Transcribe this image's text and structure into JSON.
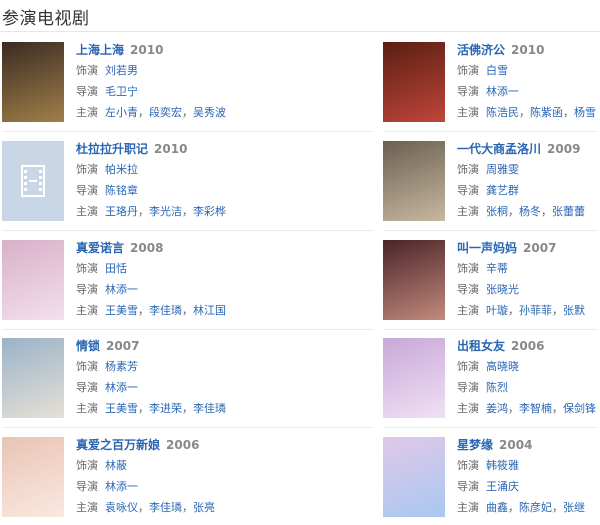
{
  "section_title": "参演电视剧",
  "role_label": "饰演",
  "director_label": "导演",
  "cast_label": "主演",
  "dramas": [
    {
      "title": "上海上海",
      "year": "2010",
      "role": "刘若男",
      "director": "毛卫宁",
      "cast": [
        "左小青",
        "段奕宏",
        "吴秀波"
      ]
    },
    {
      "title": "活佛济公",
      "year": "2010",
      "role": "白雪",
      "director": "林添一",
      "cast": [
        "陈浩民",
        "陈紫函",
        "杨雪"
      ]
    },
    {
      "title": "杜拉拉升职记",
      "year": "2010",
      "role": "帕米拉",
      "director": "陈铭章",
      "cast": [
        "王珞丹",
        "李光洁",
        "李彩桦"
      ]
    },
    {
      "title": "一代大商孟洛川",
      "year": "2009",
      "role": "周雅雯",
      "director": "龚艺群",
      "cast": [
        "张桐",
        "杨冬",
        "张蕾蕾"
      ]
    },
    {
      "title": "真爱诺言",
      "year": "2008",
      "role": "田恬",
      "director": "林添一",
      "cast": [
        "王美雪",
        "李佳璘",
        "林江国"
      ]
    },
    {
      "title": "叫一声妈妈",
      "year": "2007",
      "role": "辛蒂",
      "director": "张晓光",
      "cast": [
        "叶璇",
        "孙菲菲",
        "张默"
      ]
    },
    {
      "title": "情锁",
      "year": "2007",
      "role": "杨素芳",
      "director": "林添一",
      "cast": [
        "王美雪",
        "李进荣",
        "李佳璘"
      ]
    },
    {
      "title": "出租女友",
      "year": "2006",
      "role": "高晓晓",
      "director": "陈烈",
      "cast": [
        "姜鸿",
        "李智楠",
        "保剑锋"
      ]
    },
    {
      "title": "真爱之百万新娘",
      "year": "2006",
      "role": "林蔽",
      "director": "林添一",
      "cast": [
        "袁咏仪",
        "李佳璘",
        "张亮"
      ]
    },
    {
      "title": "星梦缘",
      "year": "2004",
      "role": "韩筱雅",
      "director": "王涌庆",
      "cast": [
        "曲鑫",
        "陈彦妃",
        "张继"
      ]
    }
  ],
  "poster_colors": [
    [
      "#3b2a22",
      "#a0804a"
    ],
    [
      "#5a1e12",
      "#c0463a"
    ],
    null,
    [
      "#6a6050",
      "#c8b8a0"
    ],
    [
      "#d8b0c8",
      "#f4e0ec"
    ],
    [
      "#4a2428",
      "#c28a7c"
    ],
    [
      "#9ab3c8",
      "#e6e0d6"
    ],
    [
      "#c8a8d8",
      "#f0e0f4"
    ],
    [
      "#e8c4b4",
      "#fbe8e0"
    ],
    [
      "#e0c8e8",
      "#a8c8f0"
    ]
  ]
}
